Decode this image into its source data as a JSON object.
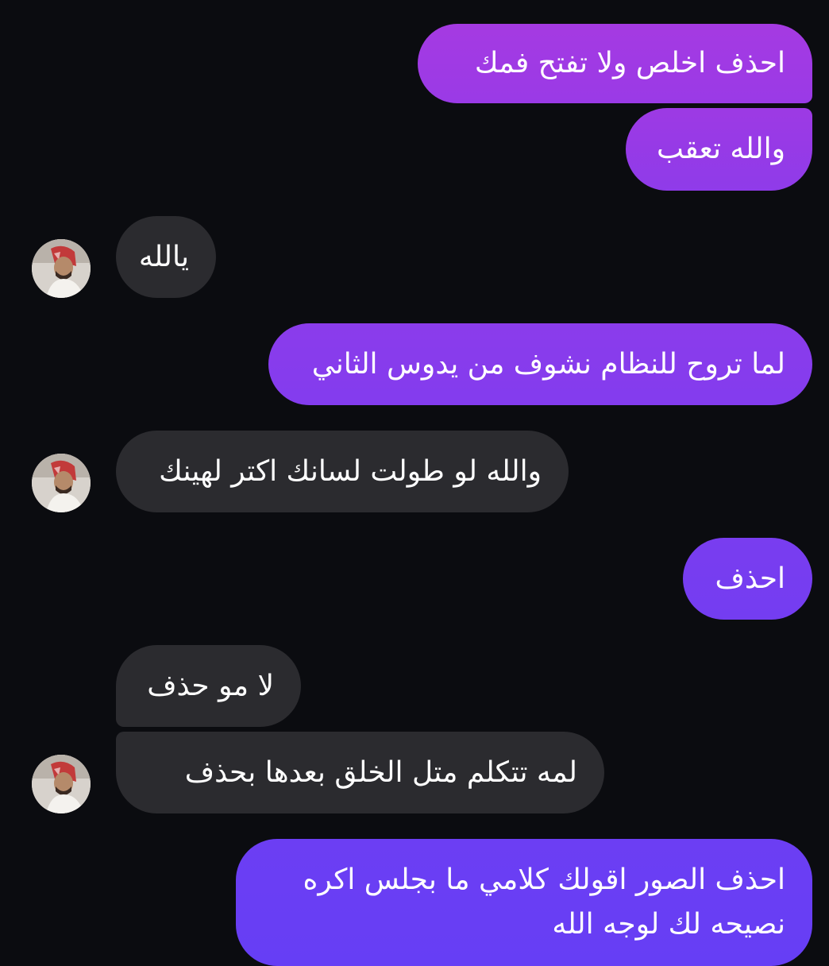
{
  "colors": {
    "background": "#0b0c10",
    "incoming_bubble": "#2b2b2f",
    "outgoing_gradient_top": "#a63ae0",
    "outgoing_gradient_bottom": "#6a3cf5",
    "text": "#ffffff"
  },
  "messages": [
    {
      "direction": "outgoing",
      "text": "احذف اخلص ولا تفتح فمك"
    },
    {
      "direction": "outgoing",
      "text": "والله تعقب"
    },
    {
      "direction": "incoming",
      "text": "يالله",
      "avatar": "contact-avatar"
    },
    {
      "direction": "outgoing",
      "text": "لما تروح للنظام نشوف من يدوس الثاني"
    },
    {
      "direction": "incoming",
      "text": "والله لو طولت لسانك اكتر لهينك",
      "avatar": "contact-avatar"
    },
    {
      "direction": "outgoing",
      "text": "احذف"
    },
    {
      "direction": "incoming",
      "text": "لا مو حذف"
    },
    {
      "direction": "incoming",
      "text": "لمه تتكلم متل الخلق بعدها بحذف",
      "avatar": "contact-avatar"
    },
    {
      "direction": "outgoing",
      "lines": [
        "احذف الصور اقولك كلامي ما بجلس اكره",
        "نصيحه لك لوجه الله"
      ]
    }
  ]
}
